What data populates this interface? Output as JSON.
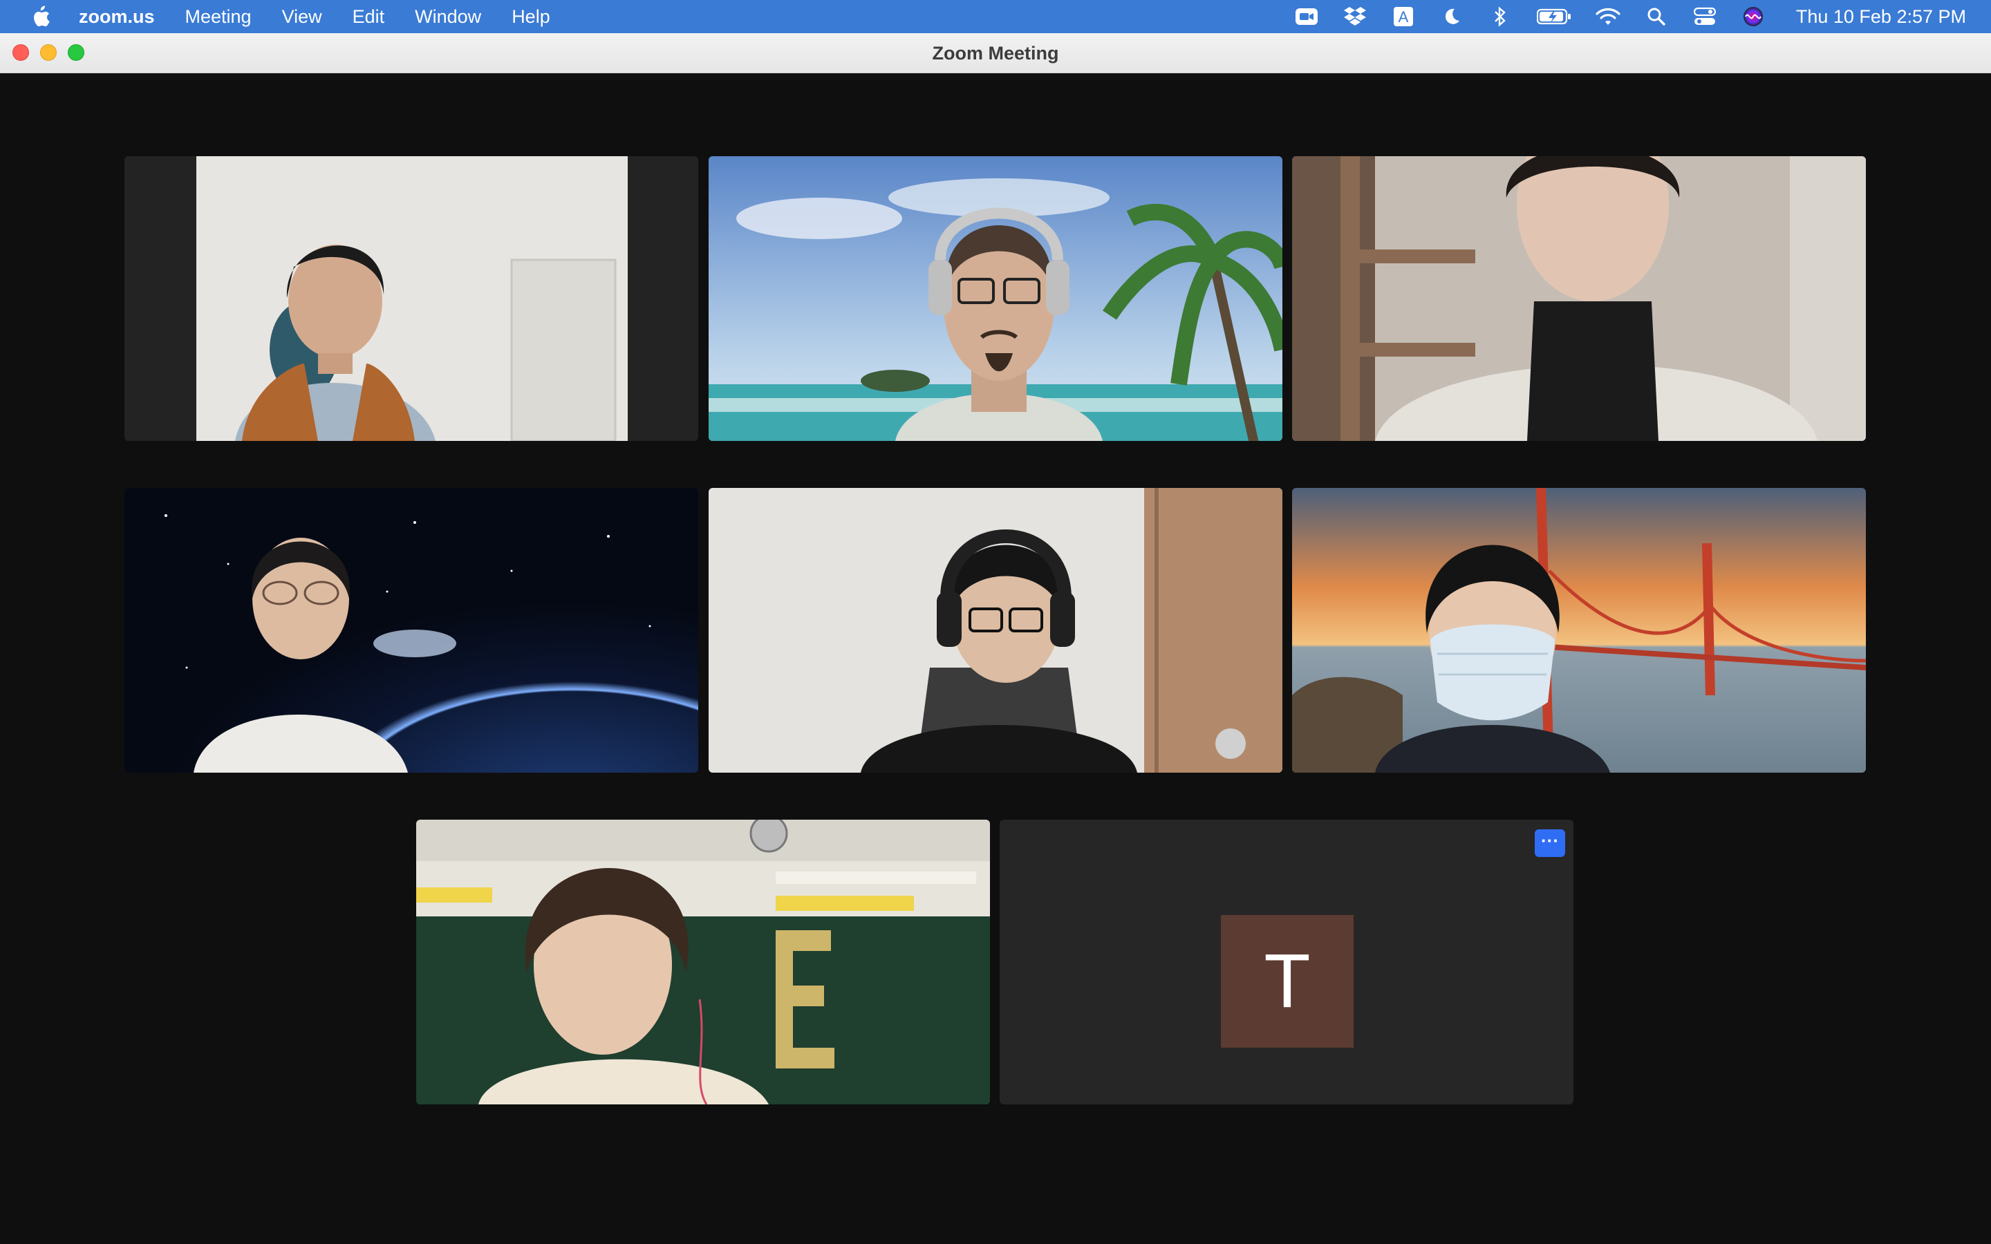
{
  "menubar": {
    "app_name": "zoom.us",
    "items": [
      "Meeting",
      "View",
      "Edit",
      "Window",
      "Help"
    ],
    "clock": "Thu 10 Feb  2:57 PM",
    "status_icons": [
      "zoom-camera-icon",
      "dropbox-icon",
      "input-source-icon",
      "focus-moon-icon",
      "bluetooth-icon",
      "battery-charging-icon",
      "wifi-icon",
      "spotlight-search-icon",
      "control-center-icon",
      "siri-icon"
    ],
    "input_source_label": "A"
  },
  "window": {
    "title": "Zoom Meeting"
  },
  "colors": {
    "menubar_bg": "#3a7bd5",
    "stage_bg": "#0f0f0f",
    "active_speaker_border": "#4fc25b",
    "avatar_bg": "#5c3b32",
    "more_button_bg": "#2f6df5"
  },
  "gallery": {
    "avatar_participant": {
      "initial": "T",
      "more_label": "···"
    }
  }
}
